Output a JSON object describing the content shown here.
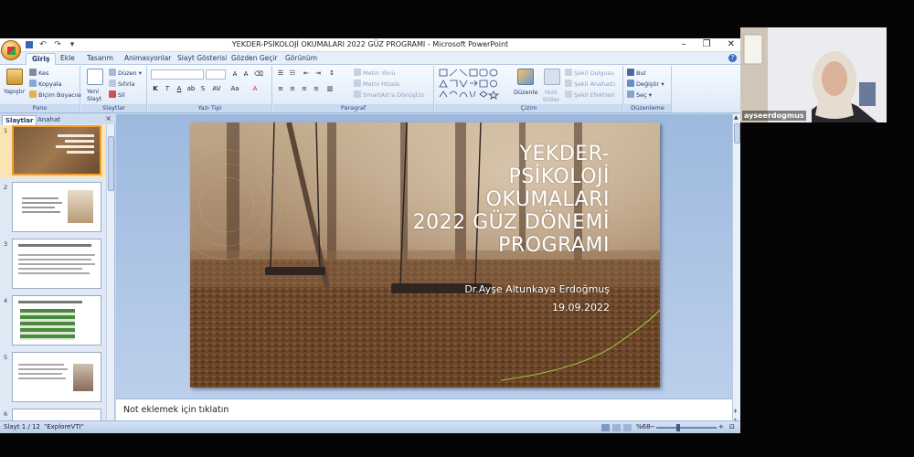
{
  "window": {
    "title": "YEKDER-PSİKOLOJİ OKUMALARI 2022 GÜZ PROGRAMI - Microsoft PowerPoint",
    "qat_icons": [
      "save-icon",
      "undo-icon",
      "redo-icon",
      "customize-icon"
    ]
  },
  "tabs": [
    "Giriş",
    "Ekle",
    "Tasarım",
    "Animasyonlar",
    "Slayt Gösterisi",
    "Gözden Geçir",
    "Görünüm"
  ],
  "ribbon": {
    "pano": {
      "label": "Pano",
      "paste": "Yapıştır",
      "cut": "Kes",
      "copy": "Kopyala",
      "format_painter": "Biçim Boyacısı"
    },
    "slaytlar": {
      "label": "Slaytlar",
      "new_slide": "Yeni Slayt",
      "layout": "Düzen",
      "reset": "Sıfırla",
      "delete": "Sil"
    },
    "yazi_tipi": {
      "label": "Yazı Tipi"
    },
    "paragraf": {
      "label": "Paragraf",
      "text_direction": "Metin Yönü",
      "align_text": "Metni Hizala",
      "smartart": "SmartArt'a Dönüştür"
    },
    "cizim": {
      "label": "Çizim",
      "arrange": "Düzenle",
      "quick_styles": "Hızlı Stiller",
      "shape_fill": "Şekil Dolgusu",
      "shape_outline": "Şekil Anahattı",
      "shape_effects": "Şekil Efektleri"
    },
    "duzenleme": {
      "label": "Düzenleme",
      "find": "Bul",
      "replace": "Değiştir",
      "select": "Seç"
    }
  },
  "panel": {
    "tab_slides": "Slaytlar",
    "tab_outline": "Anahat",
    "thumbs": [
      "1",
      "2",
      "3",
      "4",
      "5",
      "6"
    ]
  },
  "slide": {
    "title_lines": [
      "YEKDER-",
      "PSİKOLOJİ",
      "OKUMALARI",
      "2022 GÜZ DÖNEMİ",
      "PROGRAMI"
    ],
    "author": "Dr.Ayşe Altunkaya Erdoğmuş",
    "date": "19.09.2022"
  },
  "notes_placeholder": "Not eklemek için tıklatın",
  "status": {
    "slide_info": "Slayt 1 / 12",
    "theme": "\"ExploreVTI\"",
    "zoom": "%68"
  },
  "webcam": {
    "name": "ayseerdogmus"
  }
}
